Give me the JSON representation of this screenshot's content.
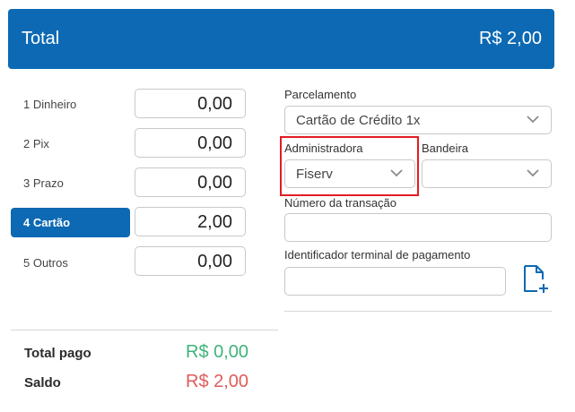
{
  "header": {
    "title": "Total",
    "total": "R$ 2,00"
  },
  "payments": [
    {
      "label": "1 Dinheiro",
      "amount": "0,00",
      "active": false
    },
    {
      "label": "2 Pix",
      "amount": "0,00",
      "active": false
    },
    {
      "label": "3 Prazo",
      "amount": "0,00",
      "active": false
    },
    {
      "label": "4 Cartão",
      "amount": "2,00",
      "active": true
    },
    {
      "label": "5 Outros",
      "amount": "0,00",
      "active": false
    }
  ],
  "summary": {
    "paid_label": "Total pago",
    "paid_value": "R$ 0,00",
    "balance_label": "Saldo",
    "balance_value": "R$ 2,00"
  },
  "form": {
    "parcelamento": {
      "label": "Parcelamento",
      "value": "Cartão de Crédito 1x"
    },
    "administradora": {
      "label": "Administradora",
      "value": "Fiserv"
    },
    "bandeira": {
      "label": "Bandeira",
      "value": ""
    },
    "transacao": {
      "label": "Número da transação",
      "value": ""
    },
    "terminal": {
      "label": "Identificador terminal de pagamento",
      "value": ""
    }
  },
  "icons": {
    "chevron": "chevron-down-icon",
    "document_add": "document-add-icon"
  },
  "colors": {
    "primary": "#0d69b3",
    "paid_green": "#3fb37a",
    "balance_red": "#e05b5b",
    "highlight_red": "#e31b23"
  }
}
